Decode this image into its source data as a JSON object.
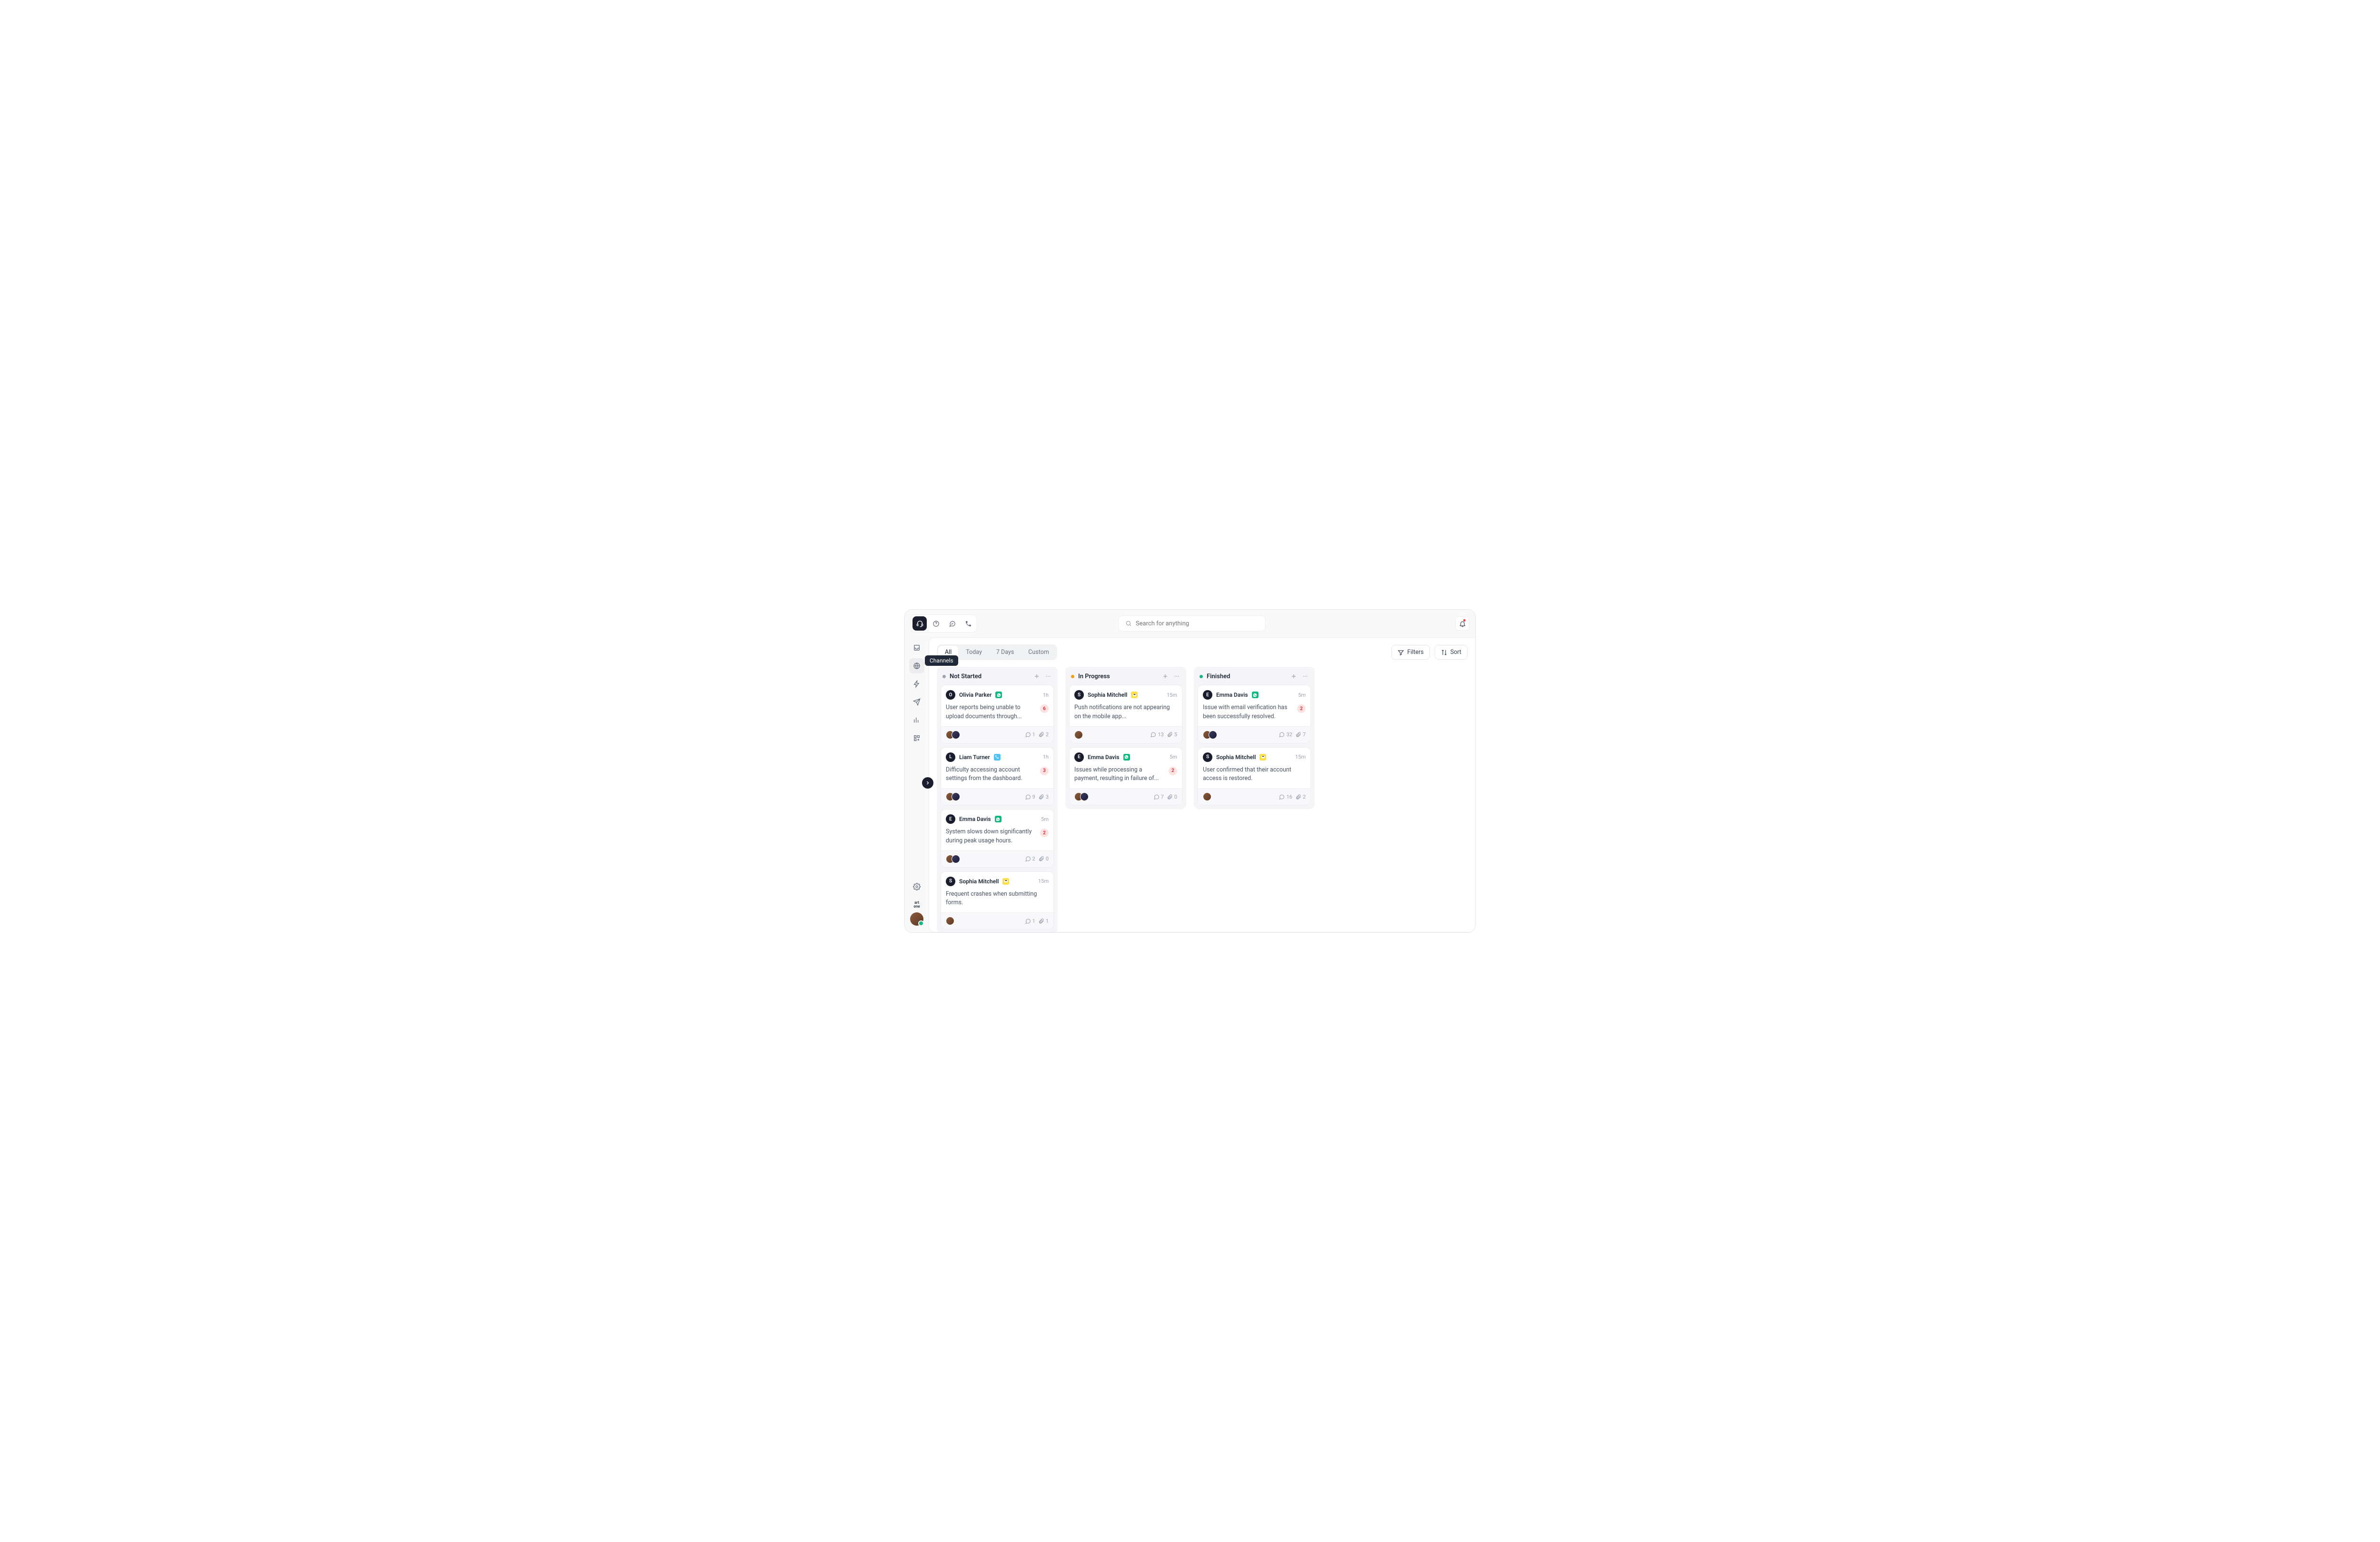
{
  "search_placeholder": "Search for anything",
  "tooltip_channels": "Channels",
  "tabs": {
    "all": "All",
    "today": "Today",
    "week": "7 Days",
    "custom": "Custom"
  },
  "buttons": {
    "filters": "Filters",
    "sort": "Sort"
  },
  "logo": "art\none",
  "colors": {
    "not_started": "#9ca3af",
    "in_progress": "#f59e0b",
    "finished": "#10b981"
  },
  "columns": [
    {
      "id": "not_started",
      "title": "Not Started",
      "cards": [
        {
          "author": "Olivia Parker",
          "initial": "O",
          "avatar_bg": "#1a1d2e",
          "channel": "whatsapp",
          "time": "1h",
          "text": "User reports being unable to upload documents through...",
          "badge": "6",
          "assignees": 2,
          "comments": "1",
          "attachments": "2"
        },
        {
          "author": "Liam Turner",
          "initial": "L",
          "avatar_bg": "#1a1d2e",
          "channel": "phone",
          "time": "1h",
          "text": "Difficulty accessing account settings from the dashboard.",
          "badge": "3",
          "assignees": 2,
          "comments": "9",
          "attachments": "3"
        },
        {
          "author": "Emma Davis",
          "initial": "E",
          "avatar_bg": "#1a1d2e",
          "channel": "whatsapp",
          "time": "5m",
          "text": "System slows down significantly during peak usage hours.",
          "badge": "2",
          "assignees": 2,
          "comments": "2",
          "attachments": "0"
        },
        {
          "author": "Sophia Mitchell",
          "initial": "S",
          "avatar_bg": "#1a1d2e",
          "channel": "email",
          "time": "15m",
          "text": "Frequent crashes when submitting forms.",
          "badge": null,
          "assignees": 1,
          "comments": "1",
          "attachments": "1"
        }
      ]
    },
    {
      "id": "in_progress",
      "title": "In Progress",
      "cards": [
        {
          "author": "Sophia Mitchell",
          "initial": "S",
          "avatar_bg": "#1a1d2e",
          "channel": "email",
          "time": "15m",
          "text": "Push notifications are not appearing on the mobile app...",
          "badge": null,
          "assignees": 1,
          "comments": "13",
          "attachments": "5"
        },
        {
          "author": "Emma Davis",
          "initial": "E",
          "avatar_bg": "#1a1d2e",
          "channel": "whatsapp",
          "time": "5m",
          "text": "Issues while processing a payment, resulting in failure of...",
          "badge": "2",
          "assignees": 2,
          "comments": "7",
          "attachments": "0"
        }
      ]
    },
    {
      "id": "finished",
      "title": "Finished",
      "cards": [
        {
          "author": "Emma Davis",
          "initial": "E",
          "avatar_bg": "#1a1d2e",
          "channel": "whatsapp",
          "time": "5m",
          "text": "Issue with email verification has been successfully resolved.",
          "badge": "2",
          "assignees": 2,
          "comments": "32",
          "attachments": "7"
        },
        {
          "author": "Sophia Mitchell",
          "initial": "S",
          "avatar_bg": "#1a1d2e",
          "channel": "email",
          "time": "15m",
          "text": "User confirmed that their account access is restored.",
          "badge": null,
          "assignees": 1,
          "comments": "16",
          "attachments": "2"
        }
      ]
    }
  ]
}
